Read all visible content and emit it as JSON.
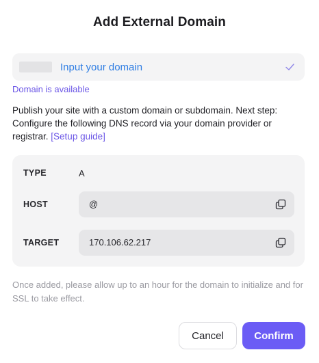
{
  "dialog": {
    "title": "Add External Domain"
  },
  "domain_input": {
    "placeholder": "Input your domain",
    "status": "Domain is available",
    "status_icon": "check-icon",
    "accent_color": "#2e7de3"
  },
  "description": {
    "text": "Publish your site with a custom domain or subdomain. Next step: Configure the following DNS record via your domain provider or registrar.",
    "link_label": "[Setup guide]"
  },
  "dns_record": {
    "type_label": "TYPE",
    "type_value": "A",
    "host_label": "HOST",
    "host_value": "@",
    "target_label": "TARGET",
    "target_value": "170.106.62.217",
    "copy_icon": "copy-icon"
  },
  "note": "Once added, please allow up to an hour for the domain to initialize and for SSL to take effect.",
  "buttons": {
    "cancel_label": "Cancel",
    "confirm_label": "Confirm",
    "confirm_color": "#6b5cf5"
  },
  "colors": {
    "link": "#6b56e6",
    "muted_text": "#9a9aa1",
    "card_bg": "#f4f4f5"
  }
}
